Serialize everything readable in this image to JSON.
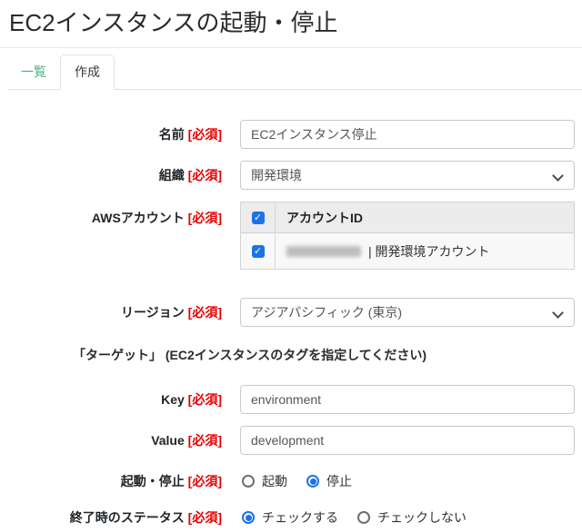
{
  "page_title": "EC2インスタンスの起動・停止",
  "tabs": {
    "list": "一覧",
    "create": "作成",
    "active_tab": "作成"
  },
  "required_badge": "[必須]",
  "icons": {
    "checkbox_check": "✓"
  },
  "form": {
    "name": {
      "label": "名前",
      "value": "EC2インスタンス停止"
    },
    "organization": {
      "label": "組織",
      "value": "開発環境"
    },
    "aws_account": {
      "label": "AWSアカウント",
      "header": "アカウントID",
      "header_checkbox_checked": true,
      "row_checkbox_checked": true,
      "row_id_masked": true,
      "row_text": "| 開発環境アカウント"
    },
    "region": {
      "label": "リージョン",
      "value": "アジアパシフィック (東京)"
    },
    "target_heading": "「ターゲット」 (EC2インスタンスのタグを指定してください)",
    "key": {
      "label": "Key",
      "value": "environment"
    },
    "value": {
      "label": "Value",
      "value": "development"
    },
    "action": {
      "label": "起動・停止",
      "option_start": "起動",
      "option_stop": "停止",
      "selected": "停止"
    },
    "end_status": {
      "label": "終了時のステータス",
      "option_check": "チェックする",
      "option_no_check": "チェックしない",
      "selected": "チェックする"
    }
  },
  "colors": {
    "tab_link_green": "#4cae7e",
    "required_red": "#e60000",
    "control_blue": "#1a73e8",
    "table_header_bg": "#ececec",
    "table_row_bg": "#f8f8f8"
  }
}
